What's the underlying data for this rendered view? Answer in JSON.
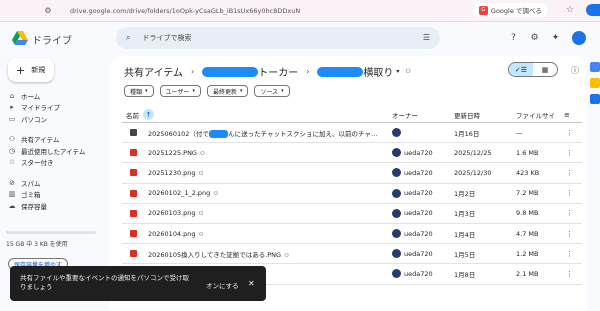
{
  "browser": {
    "url": "drive.google.com/drive/folders/1oOpk-yCsaGLb_iB1sUx66y0hc8DDxuN",
    "translate_label": "Google で調べる"
  },
  "header": {
    "app_name": "ドライブ",
    "search_placeholder": "ドライブで検索"
  },
  "sidebar": {
    "new_label": "新規",
    "items": [
      {
        "label": "ホーム",
        "icon": "home-icon"
      },
      {
        "label": "マイドライブ",
        "icon": "drive-icon"
      },
      {
        "label": "パソコン",
        "icon": "computer-icon"
      },
      {
        "label": "共有アイテム",
        "icon": "shared-icon"
      },
      {
        "label": "最近使用したアイテム",
        "icon": "clock-icon"
      },
      {
        "label": "スター付き",
        "icon": "star-icon"
      },
      {
        "label": "スパム",
        "icon": "spam-icon"
      },
      {
        "label": "ゴミ箱",
        "icon": "trash-icon"
      },
      {
        "label": "保存容量",
        "icon": "cloud-icon"
      }
    ],
    "storage_text": "15 GB 中 3 KB を使用",
    "storage_button": "保存容量を増やす"
  },
  "main": {
    "breadcrumb_root": "共有アイテム",
    "breadcrumb_mid_suffix": "トーカー",
    "breadcrumb_current_suffix": "横取り",
    "filters": [
      "種類",
      "ユーザー",
      "最終更新",
      "ソース"
    ],
    "columns": {
      "name": "名前",
      "owner": "オーナー",
      "date": "更新日時",
      "size": "ファイルサイ"
    },
    "rows": [
      {
        "type": "folder",
        "name": "2025060102（付で",
        "name_tail": "んに送ったチャットスクショに加え、以前のチャ…",
        "shared": false,
        "owner": "",
        "date": "1月16日",
        "size": "—"
      },
      {
        "type": "img",
        "name": "20251225.PNG",
        "shared": true,
        "owner": "ueda720",
        "date": "2025/12/25",
        "size": "1.6 MB"
      },
      {
        "type": "img",
        "name": "20251230.png",
        "shared": true,
        "owner": "ueda720",
        "date": "2025/12/30",
        "size": "423 KB"
      },
      {
        "type": "img",
        "name": "20260102_1_2.png",
        "shared": true,
        "owner": "ueda720",
        "date": "1月2日",
        "size": "7.2 MB"
      },
      {
        "type": "img",
        "name": "20260103.png",
        "shared": true,
        "owner": "ueda720",
        "date": "1月3日",
        "size": "9.8 MB"
      },
      {
        "type": "img",
        "name": "20260104.png",
        "shared": true,
        "owner": "ueda720",
        "date": "1月4日",
        "size": "4.7 MB"
      },
      {
        "type": "img",
        "name": "20260105換入りしてきた証拠ではある.PNG",
        "shared": true,
        "owner": "ueda720",
        "date": "1月5日",
        "size": "1.2 MB"
      },
      {
        "type": "img",
        "name": "",
        "shared": false,
        "owner": "ueda720",
        "date": "1月8日",
        "size": "2.1 MB"
      }
    ]
  },
  "snackbar": {
    "message": "共有ファイルや重要なイベントの通知をパソコンで受け取りましょう",
    "action": "オンにする",
    "close": "✕"
  },
  "colors": {
    "accent": "#0b57d0",
    "selected": "#c2e7ff",
    "redaction": "#1d8cf8"
  }
}
